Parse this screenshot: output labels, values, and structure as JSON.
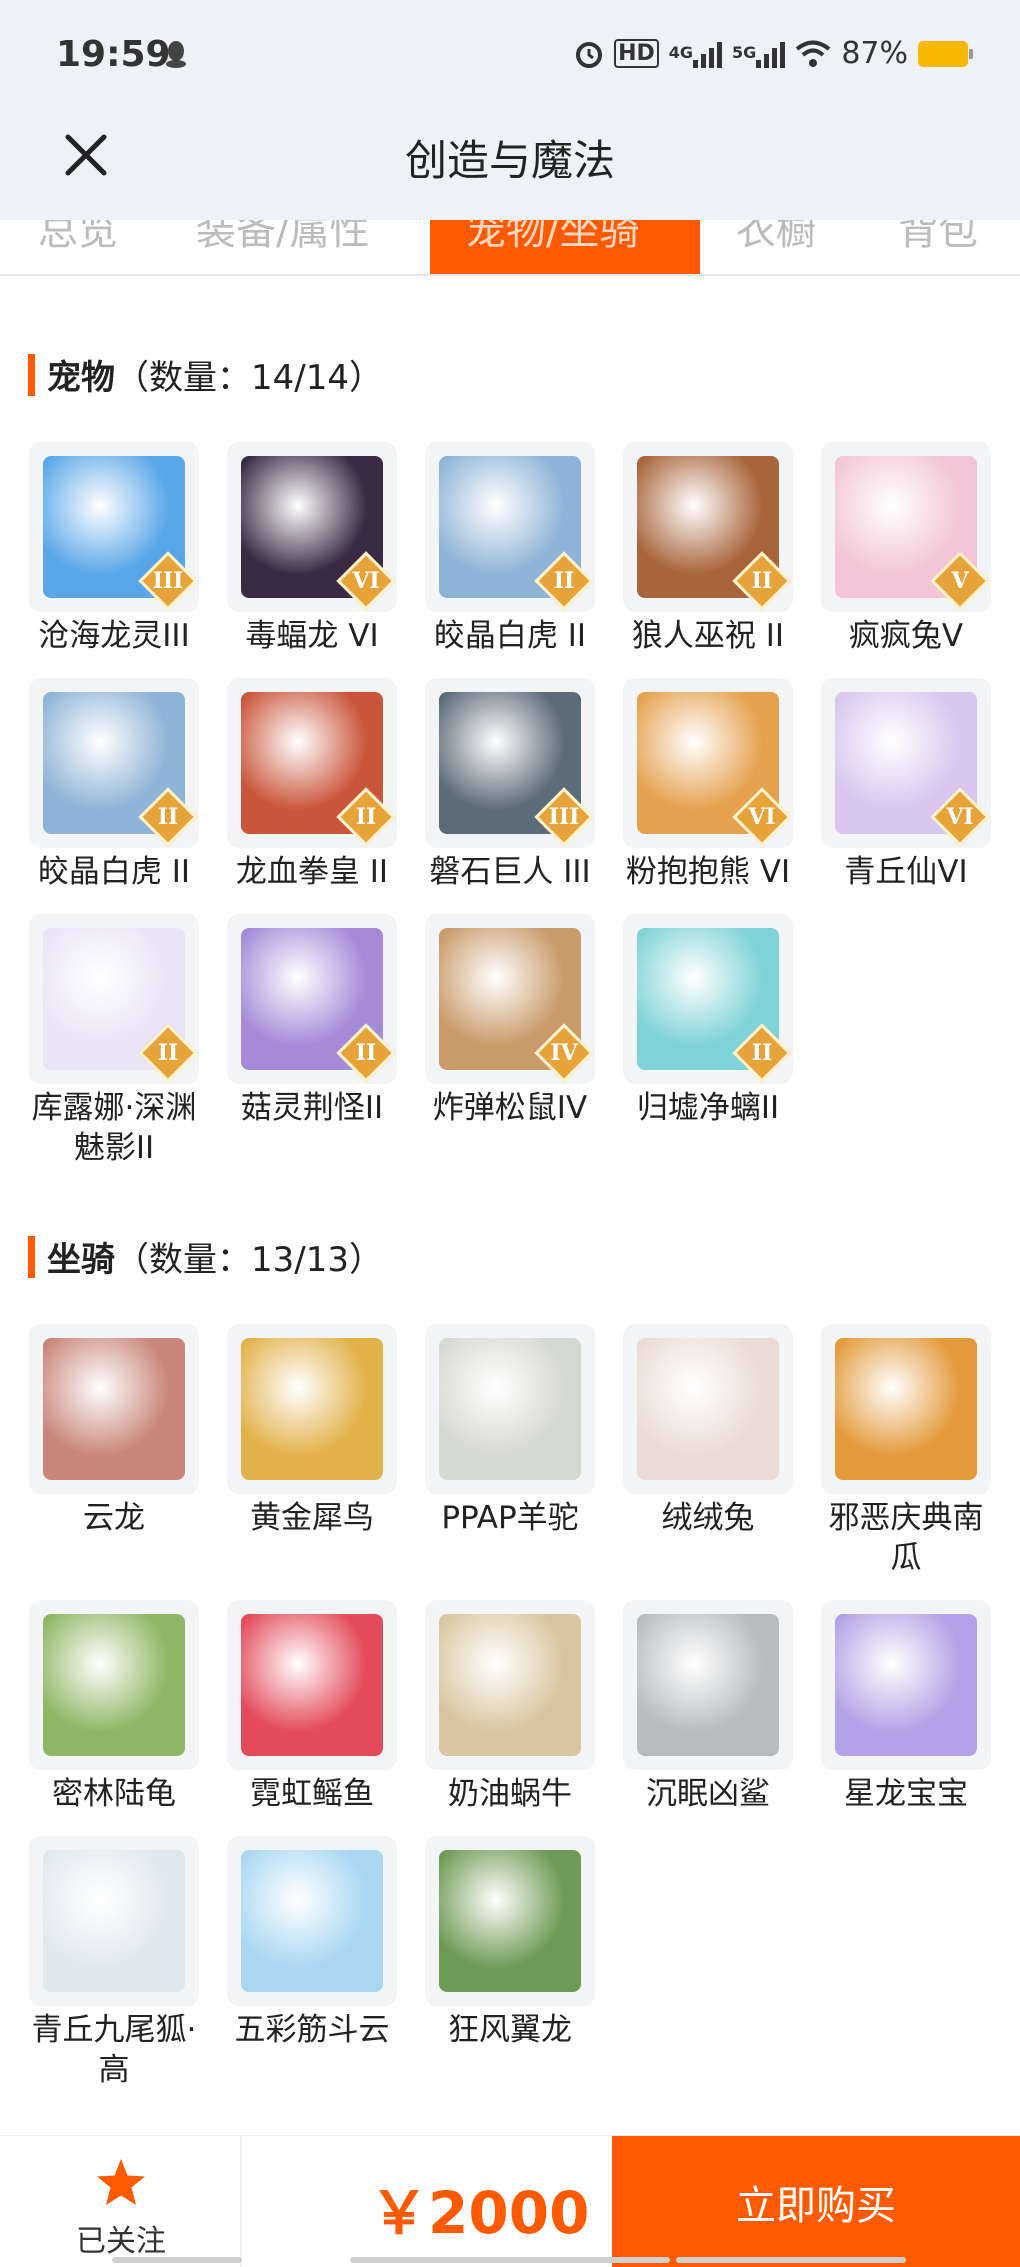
{
  "status_bar": {
    "time": "19:59",
    "battery": "87%",
    "icons": [
      "qq-icon",
      "alarm-icon",
      "hd-icon",
      "signal-4g-icon",
      "signal-5g-icon",
      "wifi-icon",
      "battery-icon"
    ],
    "network_4g": "4G",
    "network_5g": "5G",
    "hd": "HD"
  },
  "header": {
    "title": "创造与魔法",
    "close_icon": "close-icon"
  },
  "tabs": [
    {
      "label": "总览",
      "active": false
    },
    {
      "label": "装备/属性",
      "active": false
    },
    {
      "label": "宠物/坐骑",
      "active": true
    },
    {
      "label": "衣橱",
      "active": false
    },
    {
      "label": "背包",
      "active": false
    }
  ],
  "pets": {
    "title": "宠物",
    "count": "（数量：14/14）",
    "items": [
      {
        "name": "沧海龙灵III",
        "badge": "III",
        "color": "#5aa7e8"
      },
      {
        "name": "毒蝠龙 VI",
        "badge": "VI",
        "color": "#3a2a44"
      },
      {
        "name": "皎晶白虎 II",
        "badge": "II",
        "color": "#8fb3d6"
      },
      {
        "name": "狼人巫祝 II",
        "badge": "II",
        "color": "#a8643a"
      },
      {
        "name": "疯疯兔V",
        "badge": "V",
        "color": "#f2c6d6"
      },
      {
        "name": "皎晶白虎 II",
        "badge": "II",
        "color": "#8fb3d6"
      },
      {
        "name": "龙血拳皇 II",
        "badge": "II",
        "color": "#c9553a"
      },
      {
        "name": "磐石巨人 III",
        "badge": "III",
        "color": "#5c6b78"
      },
      {
        "name": "粉抱抱熊 VI",
        "badge": "VI",
        "color": "#e5a14e"
      },
      {
        "name": "青丘仙VI",
        "badge": "VI",
        "color": "#d8c6ee"
      },
      {
        "name": "库露娜·深渊魅影II",
        "badge": "II",
        "color": "#e9e4f6"
      },
      {
        "name": "菇灵荆怪II",
        "badge": "II",
        "color": "#a58ad8"
      },
      {
        "name": "炸弹松鼠IV",
        "badge": "IV",
        "color": "#c99a6a"
      },
      {
        "name": "归墟净螭II",
        "badge": "II",
        "color": "#7fd3d6"
      }
    ]
  },
  "mounts": {
    "title": "坐骑",
    "count": "（数量：13/13）",
    "items": [
      {
        "name": "云龙",
        "color": "#c9867a"
      },
      {
        "name": "黄金犀鸟",
        "color": "#e2b24a"
      },
      {
        "name": "PPAP羊驼",
        "color": "#d6d8d2"
      },
      {
        "name": "绒绒兔",
        "color": "#eadcd4"
      },
      {
        "name": "邪恶庆典南瓜",
        "color": "#e39a3a"
      },
      {
        "name": "密林陆龟",
        "color": "#8fb665"
      },
      {
        "name": "霓虹鳐鱼",
        "color": "#e34a5a"
      },
      {
        "name": "奶油蜗牛",
        "color": "#d9c6a0"
      },
      {
        "name": "沉眠凶鲨",
        "color": "#b9bcbf"
      },
      {
        "name": "星龙宝宝",
        "color": "#b4a2e6"
      },
      {
        "name": "青丘九尾狐·高",
        "color": "#dfe9ee"
      },
      {
        "name": "五彩筋斗云",
        "color": "#a9d7f2"
      },
      {
        "name": "狂风翼龙",
        "color": "#6f9a55"
      }
    ]
  },
  "bottom_bar": {
    "follow_label": "已关注",
    "price": "￥2000",
    "buy_label": "立即购买",
    "accent": "#ff5a00"
  }
}
